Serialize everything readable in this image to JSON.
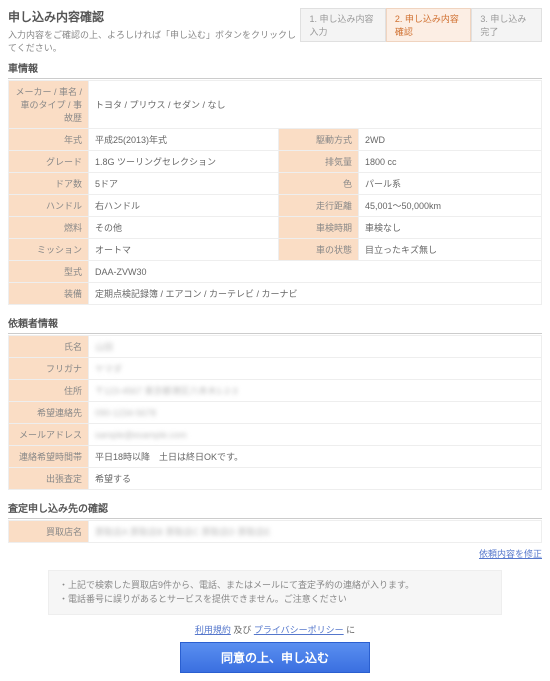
{
  "header": {
    "title": "申し込み内容確認",
    "sub": "入力内容をご確認の上、よろしければ「申し込む」ボタンをクリックしてください。"
  },
  "steps": [
    {
      "label": "1. 申し込み内容入力"
    },
    {
      "label": "2. 申し込み内容確認"
    },
    {
      "label": "3. 申し込み完了"
    }
  ],
  "car": {
    "heading": "車情報",
    "r1": {
      "k": "メーカー / 車名 /\n車のタイプ / 事故歴",
      "v": "トヨタ / プリウス / セダン / なし"
    },
    "r2": {
      "k1": "年式",
      "v1": "平成25(2013)年式",
      "k2": "駆動方式",
      "v2": "2WD"
    },
    "r3": {
      "k1": "グレード",
      "v1": "1.8G ツーリングセレクション",
      "k2": "排気量",
      "v2": "1800 cc"
    },
    "r4": {
      "k1": "ドア数",
      "v1": "5ドア",
      "k2": "色",
      "v2": "パール系"
    },
    "r5": {
      "k1": "ハンドル",
      "v1": "右ハンドル",
      "k2": "走行距離",
      "v2": "45,001〜50,000km"
    },
    "r6": {
      "k1": "燃料",
      "v1": "その他",
      "k2": "車検時期",
      "v2": "車検なし"
    },
    "r7": {
      "k1": "ミッション",
      "v1": "オートマ",
      "k2": "車の状態",
      "v2": "目立ったキズ無し"
    },
    "r8": {
      "k": "型式",
      "v": "DAA-ZVW30"
    },
    "r9": {
      "k": "装備",
      "v": "定期点検記録簿 / エアコン / カーテレビ / カーナビ"
    }
  },
  "req": {
    "heading": "依頼者情報",
    "r1": {
      "k": "氏名",
      "v": "山田"
    },
    "r2": {
      "k": "フリガナ",
      "v": "ヤマダ"
    },
    "r3": {
      "k": "住所",
      "v": "〒123-4567 東京都港区六本木1-2-3"
    },
    "r4": {
      "k": "希望連絡先",
      "v": "090-1234-5678"
    },
    "r5": {
      "k": "メールアドレス",
      "v": "sample@example.com"
    },
    "r6": {
      "k": "連絡希望時間帯",
      "v": "平日18時以降　土日は終日OKです。"
    },
    "r7": {
      "k": "出張査定",
      "v": "希望する"
    }
  },
  "dealer": {
    "heading": "査定申し込み先の確認",
    "k": "買取店名",
    "v": "買取店A 買取店B 買取店C 買取店D 買取店E"
  },
  "correct": "依頼内容を修正",
  "note1": "・上記で検索した買取店9件から、電話、またはメールにて査定予約の連絡が入ります。",
  "note2": "・電話番号に誤りがあるとサービスを提供できません。ご注意ください",
  "agree1": "利用規約",
  "agree2": " 及び ",
  "agree3": "プライバシーポリシー",
  "agree4": " に",
  "submit": "同意の上、申し込む"
}
